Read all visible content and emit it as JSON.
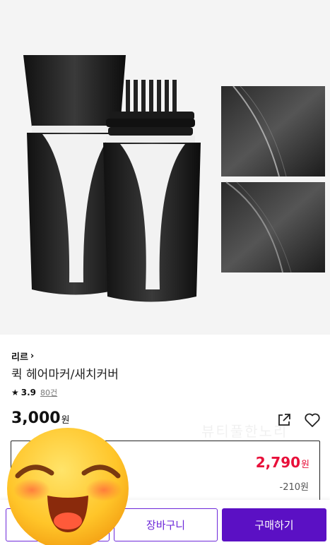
{
  "brand": {
    "name": "리르",
    "chevron": "›"
  },
  "product": {
    "title": "퀵 헤어마커/새치커버"
  },
  "rating": {
    "star": "★",
    "score": "3.9",
    "count": "80건"
  },
  "price": {
    "amount": "3,000",
    "unit": "원"
  },
  "watermark": "뷰티풀한노리",
  "coupon": {
    "amount": "2,790",
    "unit": "원",
    "discount": "-210원"
  },
  "actions": {
    "cart": "장바구니",
    "buy": "구매하기"
  },
  "icons": {
    "share": "share-icon",
    "wishlist": "heart-icon",
    "emoji": "laughing-face-emoji"
  },
  "colors": {
    "accent": "#5b10c4",
    "sale": "#e8103a"
  }
}
